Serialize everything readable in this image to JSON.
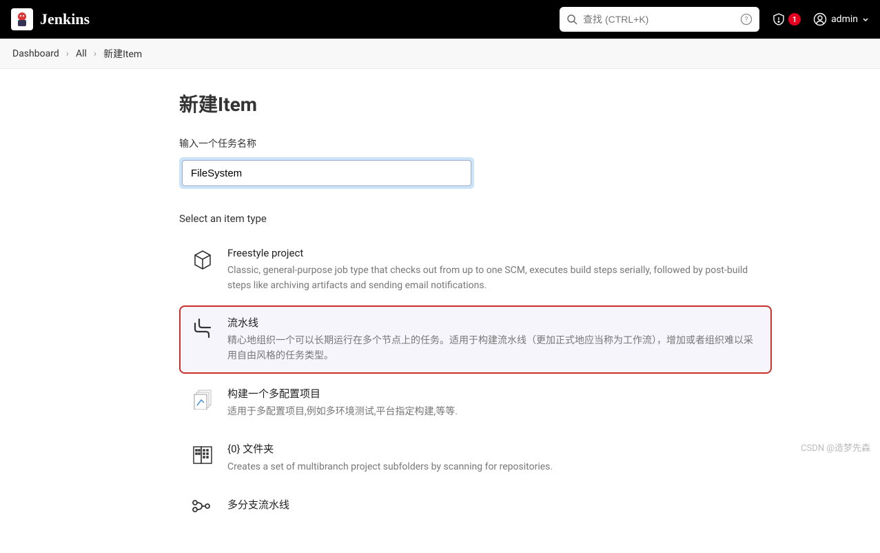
{
  "header": {
    "logo": "Jenkins",
    "search_placeholder": "查找 (CTRL+K)",
    "alert_count": "1",
    "user": "admin"
  },
  "breadcrumb": {
    "items": [
      "Dashboard",
      "All",
      "新建Item"
    ]
  },
  "page": {
    "title": "新建Item",
    "name_label": "输入一个任务名称",
    "name_value": "FileSystem",
    "section_label": "Select an item type"
  },
  "types": [
    {
      "title": "Freestyle project",
      "desc": "Classic, general-purpose job type that checks out from up to one SCM, executes build steps serially, followed by post-build steps like archiving artifacts and sending email notifications.",
      "selected": false
    },
    {
      "title": "流水线",
      "desc": "精心地组织一个可以长期运行在多个节点上的任务。适用于构建流水线（更加正式地应当称为工作流），增加或者组织难以采用自由风格的任务类型。",
      "selected": true
    },
    {
      "title": "构建一个多配置项目",
      "desc": "适用于多配置项目,例如多环境测试,平台指定构建,等等.",
      "selected": false
    },
    {
      "title": "{0} 文件夹",
      "desc": "Creates a set of multibranch project subfolders by scanning for repositories.",
      "selected": false
    },
    {
      "title": "多分支流水线",
      "desc": "",
      "selected": false
    }
  ],
  "watermark": "CSDN @造梦先森"
}
